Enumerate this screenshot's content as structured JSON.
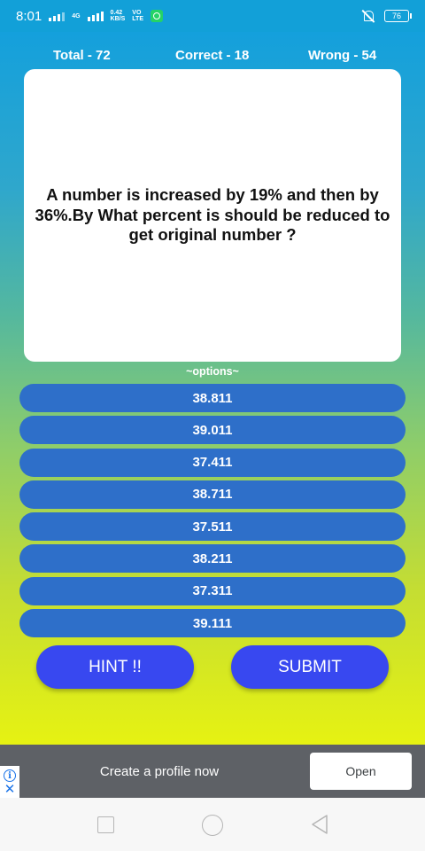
{
  "status_bar": {
    "time": "8:01",
    "network_type": "4G",
    "net_speed": "0.42",
    "net_speed_unit": "KB/S",
    "volte_top": "VO",
    "volte_bottom": "LTE",
    "battery": "76",
    "icons": [
      "signal-icon",
      "whatsapp-icon",
      "mute-icon",
      "battery-icon"
    ]
  },
  "stats": {
    "total": "Total - 72",
    "correct": "Correct - 18",
    "wrong": "Wrong - 54"
  },
  "question": "A number is increased by 19% and then by 36%.By What percent is should be reduced to get original number ?",
  "options_label": "~options~",
  "options": [
    "38.811",
    "39.011",
    "37.411",
    "38.711",
    "37.511",
    "38.211",
    "37.311",
    "39.111"
  ],
  "buttons": {
    "hint": "HINT !!",
    "submit": "SUBMIT"
  },
  "ad": {
    "text": "Create a profile now",
    "cta": "Open"
  },
  "colors": {
    "option_bg": "#2e6fc9",
    "button_bg": "#3848f0",
    "gradient_top": "#14a0dc",
    "gradient_bottom": "#e6f212"
  }
}
